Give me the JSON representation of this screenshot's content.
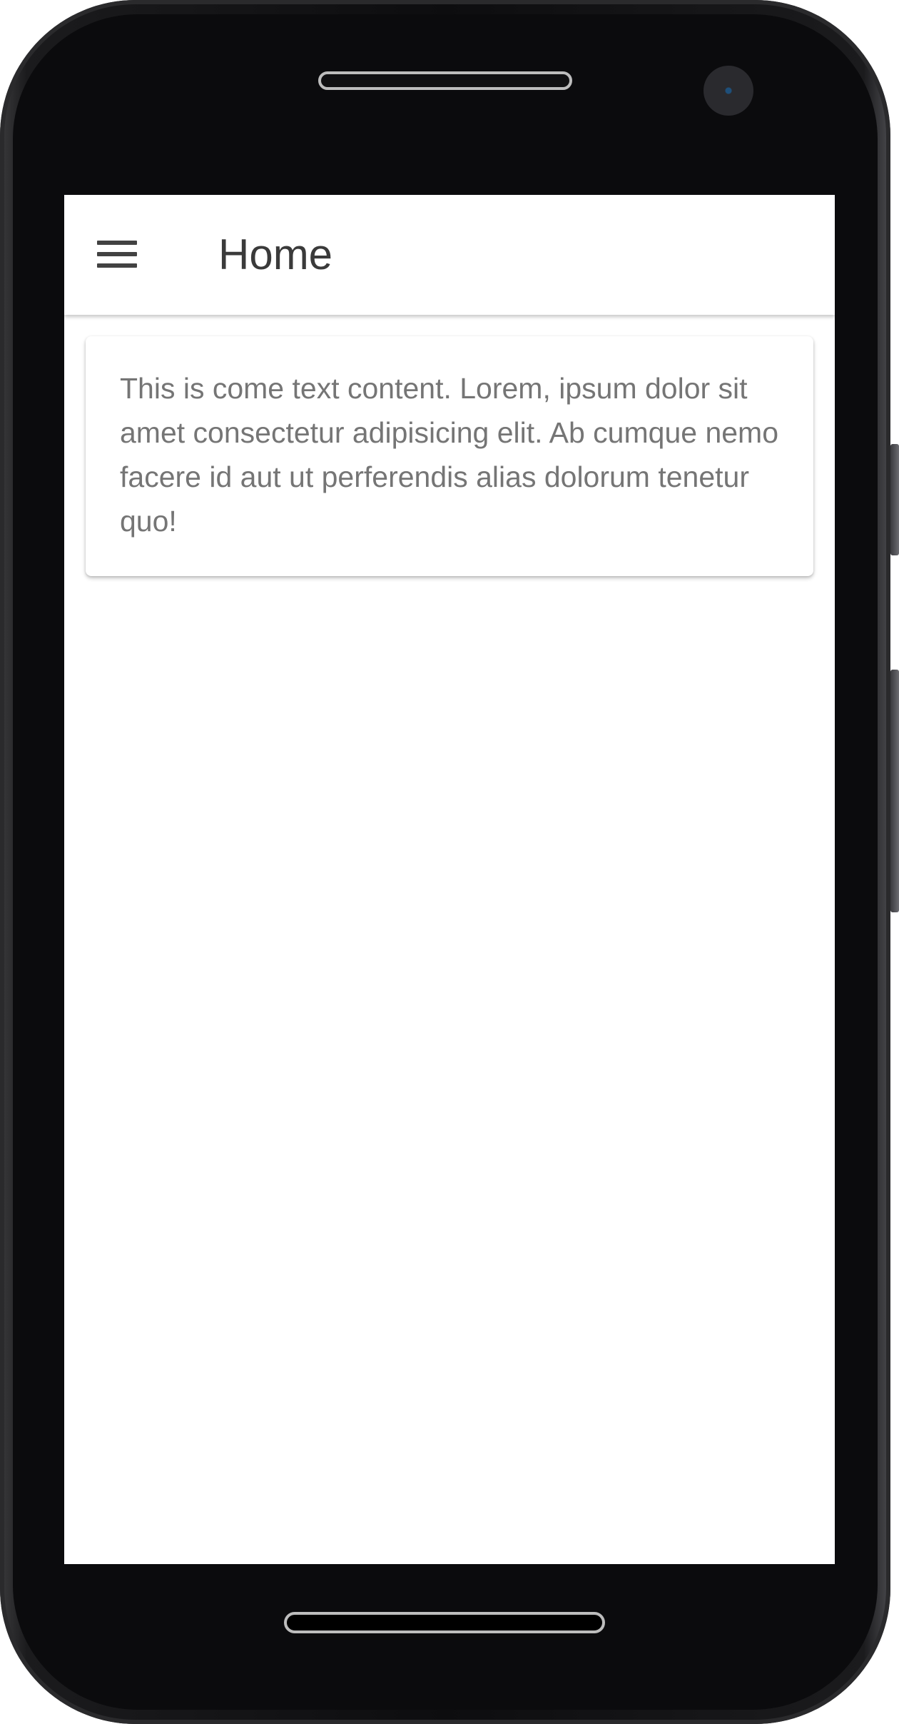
{
  "app_bar": {
    "menu_icon": "hamburger-menu-icon",
    "title": "Home"
  },
  "content": {
    "card_text": "This is come text content. Lorem, ipsum dolor sit amet consectetur adipisicing elit. Ab cumque nemo facere id aut ut perferendis alias dolorum tenetur quo!"
  },
  "colors": {
    "screen_background": "#ffffff",
    "title_text": "#3a3a3a",
    "body_text": "#757575",
    "icon": "#424242",
    "device_frame": "#0b0b0d"
  }
}
